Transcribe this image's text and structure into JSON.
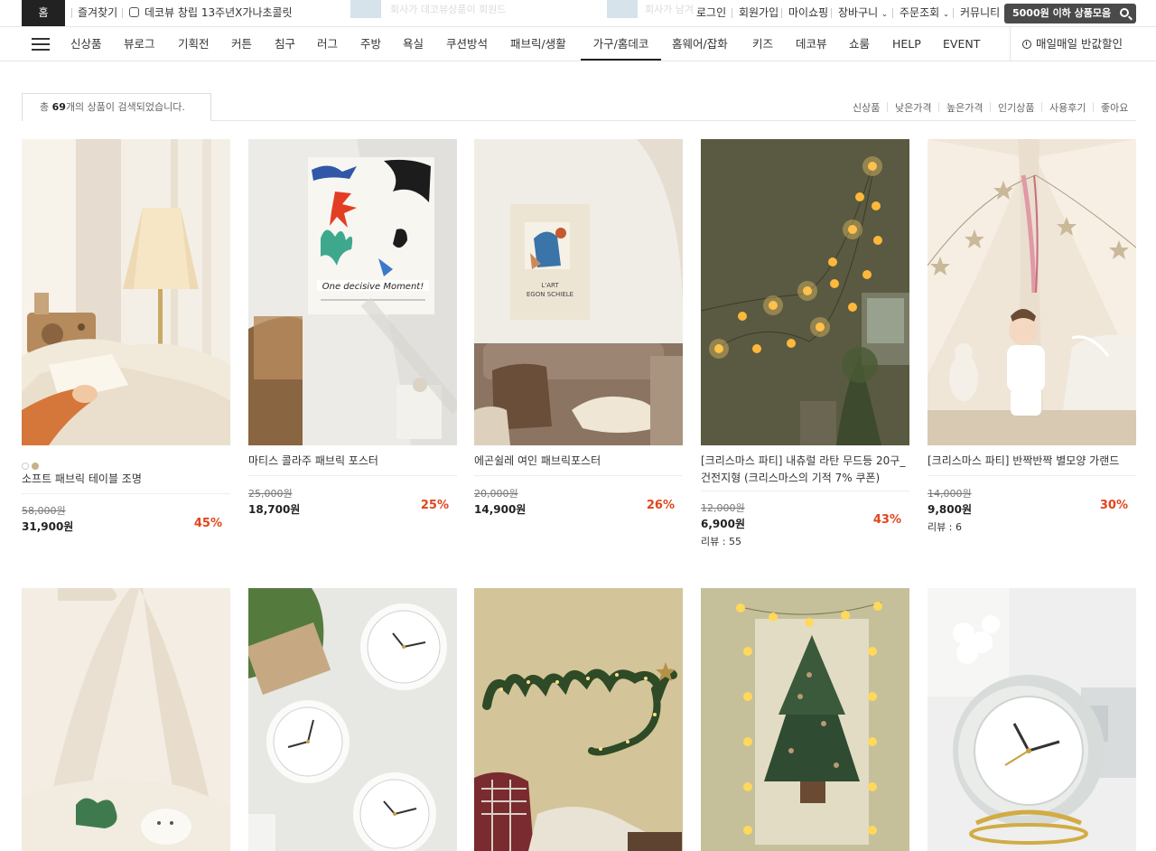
{
  "topbar": {
    "home": "홈",
    "favorites": "즐겨찾기",
    "notice": "데코뷰 창립 13주년X가나초콜릿",
    "ghost_banner_1": "회사가 데코뷰상품이 회원드",
    "ghost_banner_2": "회사가 남겨",
    "links": [
      "로그인",
      "회원가입",
      "마이쇼핑",
      "장바구니",
      "주문조회",
      "커뮤니티"
    ],
    "deal_button": "5000원 이하 상품모음"
  },
  "nav": {
    "items": [
      "신상품",
      "뷰로그",
      "기획전",
      "커튼",
      "침구",
      "러그",
      "주방",
      "욕실",
      "쿠션방석",
      "패브릭/생활",
      "가구/홈데코",
      "홈웨어/잡화",
      "키즈",
      "데코뷰",
      "쇼룸",
      "HELP",
      "EVENT"
    ],
    "active": "가구/홈데코",
    "right_label": "매일매일 반값할인"
  },
  "results": {
    "prefix": "총",
    "count": "69",
    "suffix": "개의 상품이 검색되었습니다."
  },
  "sort_options": [
    "신상품",
    "낮은가격",
    "높은가격",
    "인기상품",
    "사용후기",
    "좋아요"
  ],
  "products": [
    {
      "name": "소프트 패브릭 테이블 조명",
      "original_price": "58,000원",
      "sale_price": "31,900원",
      "discount": "45%",
      "reviews": "",
      "swatch_colors": [
        "#ffffff",
        "#c8b08a"
      ]
    },
    {
      "name": "마티스 콜라주 패브릭 포스터",
      "original_price": "25,000원",
      "sale_price": "18,700원",
      "discount": "25%",
      "reviews": ""
    },
    {
      "name": "에곤쉴레 여인 패브릭포스터",
      "original_price": "20,000원",
      "sale_price": "14,900원",
      "discount": "26%",
      "reviews": ""
    },
    {
      "name": "[크리스마스 파티] 내츄럴 라탄 무드등 20구_건전지형 (크리스마스의 기적 7% 쿠폰)",
      "original_price": "12,000원",
      "sale_price": "6,900원",
      "discount": "43%",
      "reviews": "리뷰 : 55"
    },
    {
      "name": "[크리스마스 파티] 반짝반짝 별모양 가랜드",
      "original_price": "14,000원",
      "sale_price": "9,800원",
      "discount": "30%",
      "reviews": "리뷰 : 6"
    }
  ],
  "colors": {
    "discount": "#e2451c",
    "home_button": "#222222",
    "deal_button": "#4a4a4a"
  }
}
